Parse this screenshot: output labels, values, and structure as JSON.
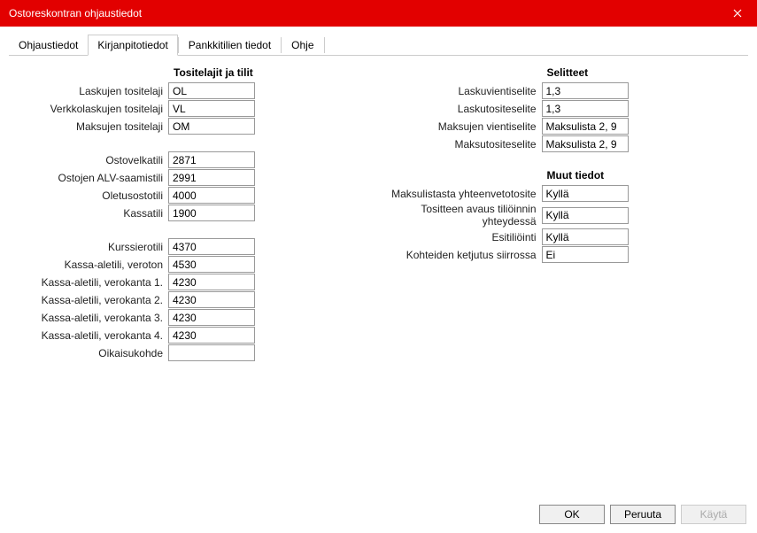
{
  "window": {
    "title": "Ostoreskontran ohjaustiedot"
  },
  "tabs": {
    "t0": "Ohjaustiedot",
    "t1": "Kirjanpitotiedot",
    "t2": "Pankkitilien tiedot",
    "t3": "Ohje"
  },
  "left": {
    "section1_header": "Tositelajit ja tilit",
    "rows": {
      "r0": {
        "label": "Laskujen tositelaji",
        "value": "OL"
      },
      "r1": {
        "label": "Verkkolaskujen tositelaji",
        "value": "VL"
      },
      "r2": {
        "label": "Maksujen tositelaji",
        "value": "OM"
      },
      "r3": {
        "label": "Ostovelkatili",
        "value": "2871"
      },
      "r4": {
        "label": "Ostojen ALV-saamistili",
        "value": "2991"
      },
      "r5": {
        "label": "Oletusostotili",
        "value": "4000"
      },
      "r6": {
        "label": "Kassatili",
        "value": "1900"
      },
      "r7": {
        "label": "Kurssierotili",
        "value": "4370"
      },
      "r8": {
        "label": "Kassa-aletili, veroton",
        "value": "4530"
      },
      "r9": {
        "label": "Kassa-aletili, verokanta 1.",
        "value": "4230"
      },
      "r10": {
        "label": "Kassa-aletili, verokanta 2.",
        "value": "4230"
      },
      "r11": {
        "label": "Kassa-aletili, verokanta 3.",
        "value": "4230"
      },
      "r12": {
        "label": "Kassa-aletili, verokanta 4.",
        "value": "4230"
      },
      "r13": {
        "label": "Oikaisukohde",
        "value": ""
      }
    }
  },
  "right": {
    "section1_header": "Selitteet",
    "rows1": {
      "r0": {
        "label": "Laskuvientiselite",
        "value": "1,3"
      },
      "r1": {
        "label": "Laskutositeselite",
        "value": "1,3"
      },
      "r2": {
        "label": "Maksujen vientiselite",
        "value": "Maksulista 2, 9"
      },
      "r3": {
        "label": "Maksutositeselite",
        "value": "Maksulista 2, 9"
      }
    },
    "section2_header": "Muut tiedot",
    "rows2": {
      "r0": {
        "label": "Maksulistasta yhteenvetotosite",
        "value": "Kyllä"
      },
      "r1": {
        "label": "Tositteen avaus tiliöinnin yhteydessä",
        "value": "Kyllä"
      },
      "r2": {
        "label": "Esitiliöinti",
        "value": "Kyllä"
      },
      "r3": {
        "label": "Kohteiden ketjutus siirrossa",
        "value": "Ei"
      }
    }
  },
  "buttons": {
    "ok": "OK",
    "cancel": "Peruuta",
    "apply": "Käytä"
  }
}
